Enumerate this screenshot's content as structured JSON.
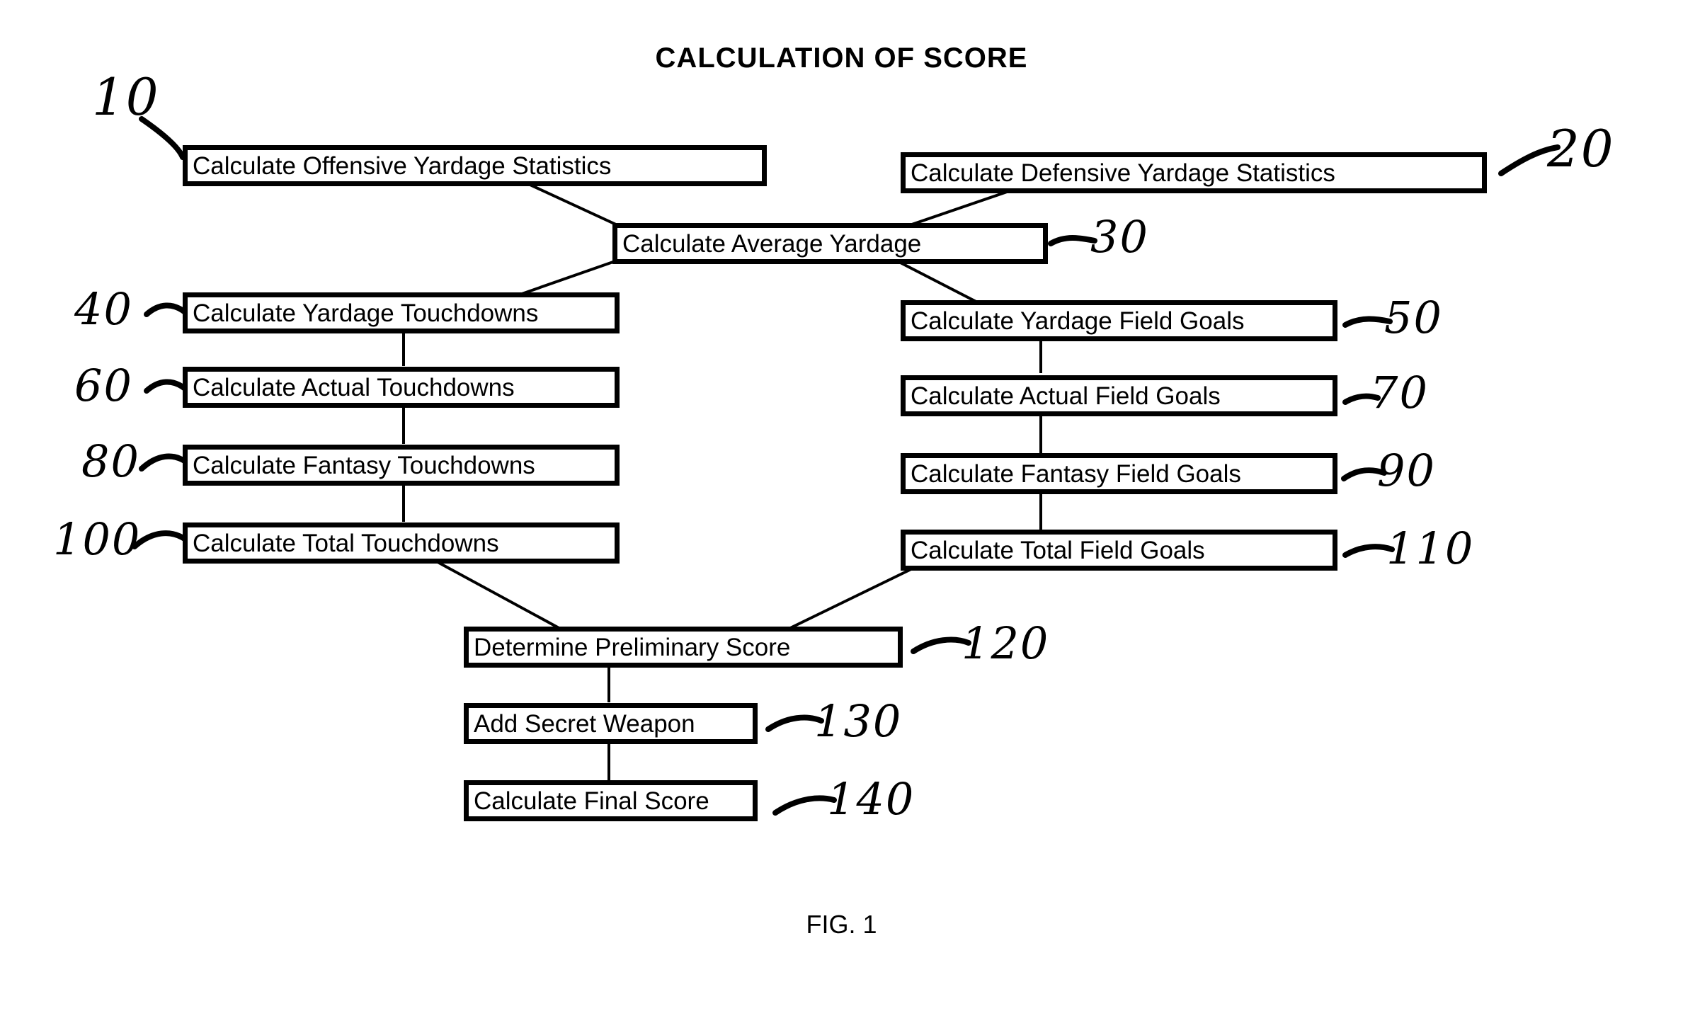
{
  "figure": {
    "title": "CALCULATION OF SCORE",
    "caption": "FIG. 1"
  },
  "nodes": [
    {
      "id": "n10",
      "label": "Calculate Offensive Yardage Statistics",
      "ref": "10"
    },
    {
      "id": "n20",
      "label": "Calculate Defensive Yardage Statistics",
      "ref": "20"
    },
    {
      "id": "n30",
      "label": "Calculate Average Yardage",
      "ref": "30"
    },
    {
      "id": "n40",
      "label": "Calculate Yardage Touchdowns",
      "ref": "40"
    },
    {
      "id": "n50",
      "label": "Calculate Yardage Field Goals",
      "ref": "50"
    },
    {
      "id": "n60",
      "label": "Calculate Actual Touchdowns",
      "ref": "60"
    },
    {
      "id": "n70",
      "label": "Calculate Actual Field Goals",
      "ref": "70"
    },
    {
      "id": "n80",
      "label": "Calculate Fantasy Touchdowns",
      "ref": "80"
    },
    {
      "id": "n90",
      "label": "Calculate Fantasy Field Goals",
      "ref": "90"
    },
    {
      "id": "n100",
      "label": "Calculate Total Touchdowns",
      "ref": "100"
    },
    {
      "id": "n110",
      "label": "Calculate Total Field Goals",
      "ref": "110"
    },
    {
      "id": "n120",
      "label": "Determine Preliminary Score",
      "ref": "120"
    },
    {
      "id": "n130",
      "label": "Add Secret Weapon",
      "ref": "130"
    },
    {
      "id": "n140",
      "label": "Calculate Final Score",
      "ref": "140"
    }
  ],
  "flow": {
    "edges": [
      {
        "from": "n10",
        "to": "n30"
      },
      {
        "from": "n20",
        "to": "n30"
      },
      {
        "from": "n30",
        "to": "n40"
      },
      {
        "from": "n30",
        "to": "n50"
      },
      {
        "from": "n40",
        "to": "n60"
      },
      {
        "from": "n60",
        "to": "n80"
      },
      {
        "from": "n80",
        "to": "n100"
      },
      {
        "from": "n50",
        "to": "n70"
      },
      {
        "from": "n70",
        "to": "n90"
      },
      {
        "from": "n90",
        "to": "n110"
      },
      {
        "from": "n100",
        "to": "n120"
      },
      {
        "from": "n110",
        "to": "n120"
      },
      {
        "from": "n120",
        "to": "n130"
      },
      {
        "from": "n130",
        "to": "n140"
      }
    ]
  },
  "colors": {
    "ink": "#000000",
    "paper": "#ffffff"
  }
}
